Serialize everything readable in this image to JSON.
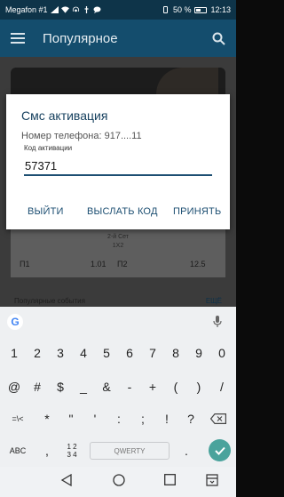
{
  "status_bar": {
    "carrier": "Megafon #1",
    "battery_percent": "50 %",
    "time": "12:13"
  },
  "app_bar": {
    "title": "Популярное",
    "menu_icon": "hamburger-menu-icon",
    "search_icon": "search-icon"
  },
  "background": {
    "set_label": "2-й Сет",
    "market_label": "1X2",
    "odds": [
      {
        "label": "П1",
        "value": "1.01"
      },
      {
        "label": "П2",
        "value": "12.5"
      }
    ],
    "section_title": "Популярные события",
    "section_link": "ЕЩЁ"
  },
  "dialog": {
    "title": "Смс активация",
    "phone_text": "Номер телефона: 917....11",
    "code_label": "Код активации",
    "code_value": "57371",
    "buttons": {
      "exit": "ВЫЙТИ",
      "resend": "ВЫСЛАТЬ КОД",
      "accept": "ПРИНЯТЬ"
    }
  },
  "keyboard": {
    "row1": [
      "1",
      "2",
      "3",
      "4",
      "5",
      "6",
      "7",
      "8",
      "9",
      "0"
    ],
    "row2": [
      "@",
      "#",
      "$",
      "_",
      "&",
      "-",
      "+",
      "(",
      ")",
      "/"
    ],
    "row3": [
      "=\\<",
      "*",
      "\"",
      "'",
      ":",
      ";",
      "!",
      "?"
    ],
    "abc_label": "ABC",
    "numpad_top": "1 2",
    "numpad_bottom": "3 4",
    "comma": ",",
    "space_label": "QWERTY",
    "period": "."
  },
  "colors": {
    "app_bar": "#144d6d",
    "status_bar": "#0e3449",
    "accent": "#1d4f72",
    "enter_key": "#4aa39c"
  }
}
